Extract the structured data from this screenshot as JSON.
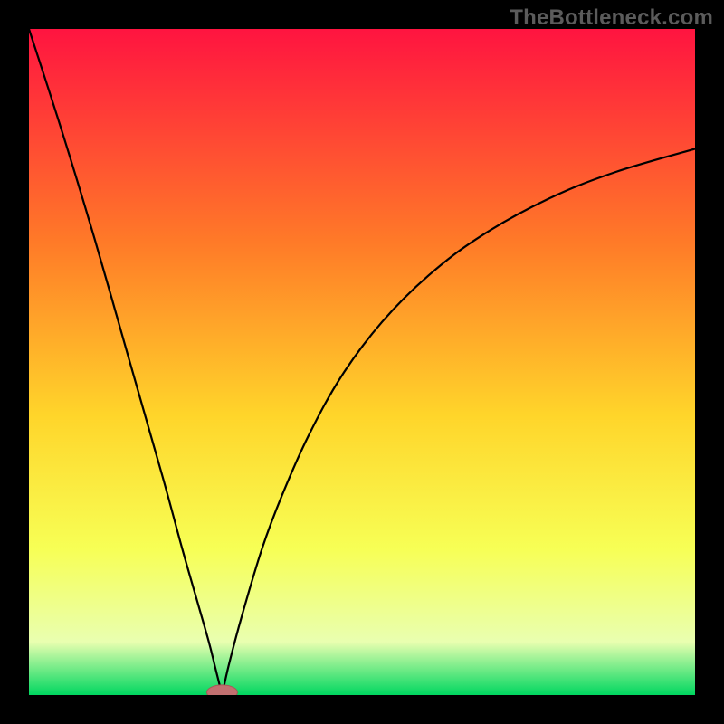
{
  "watermark": "TheBottleneck.com",
  "colors": {
    "top": "#ff1440",
    "mid_upper": "#ff7a28",
    "mid": "#ffd52a",
    "mid_lower": "#f7ff55",
    "low": "#e9ffb0",
    "bottom": "#00d760",
    "curve": "#000000",
    "marker_fill": "#c27070",
    "marker_stroke": "#a85858",
    "frame": "#000000"
  },
  "chart_data": {
    "type": "line",
    "title": "",
    "xlabel": "",
    "ylabel": "",
    "xlim": [
      0,
      100
    ],
    "ylim": [
      0,
      100
    ],
    "curve_description": "V-shaped bottleneck curve: steep descent to vertex, then shallower rise approaching an asymptote near 80%",
    "vertex": {
      "x": 29,
      "y": 0
    },
    "left_branch": [
      {
        "x": 0,
        "y": 100
      },
      {
        "x": 5,
        "y": 84.5
      },
      {
        "x": 10,
        "y": 68
      },
      {
        "x": 15,
        "y": 50.5
      },
      {
        "x": 20,
        "y": 33
      },
      {
        "x": 23,
        "y": 22
      },
      {
        "x": 25,
        "y": 15
      },
      {
        "x": 27,
        "y": 8
      },
      {
        "x": 28,
        "y": 4
      },
      {
        "x": 29,
        "y": 0
      }
    ],
    "right_branch": [
      {
        "x": 29,
        "y": 0
      },
      {
        "x": 30,
        "y": 4.5
      },
      {
        "x": 32,
        "y": 12
      },
      {
        "x": 35,
        "y": 22
      },
      {
        "x": 38,
        "y": 30
      },
      {
        "x": 42,
        "y": 39
      },
      {
        "x": 47,
        "y": 48
      },
      {
        "x": 53,
        "y": 56
      },
      {
        "x": 60,
        "y": 63
      },
      {
        "x": 68,
        "y": 69
      },
      {
        "x": 78,
        "y": 74.5
      },
      {
        "x": 88,
        "y": 78.5
      },
      {
        "x": 100,
        "y": 82
      }
    ],
    "marker": {
      "x": 29,
      "y": 0,
      "rx": 2.3,
      "ry": 1.1
    }
  }
}
